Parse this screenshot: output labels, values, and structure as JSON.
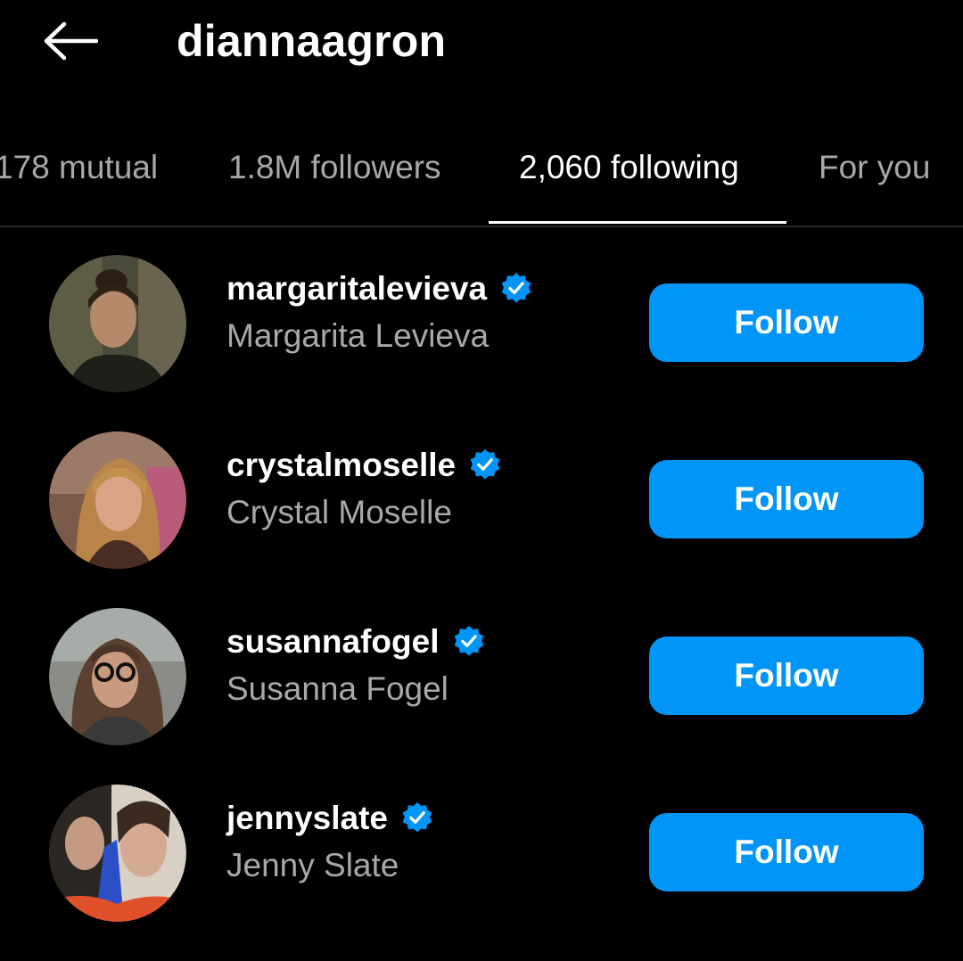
{
  "header": {
    "back_icon": "arrow-left-icon",
    "title": "diannaagron"
  },
  "tabs": [
    {
      "label": "178 mutual",
      "active": false
    },
    {
      "label": "1.8M followers",
      "active": false
    },
    {
      "label": "2,060 following",
      "active": true
    },
    {
      "label": "For you",
      "active": false
    }
  ],
  "colors": {
    "background": "#000000",
    "accent": "#0095f6",
    "secondary_text": "#a8a8a8"
  },
  "users": [
    {
      "username": "margaritalevieva",
      "name": "Margarita Levieva",
      "verified": true,
      "verified_icon": "verified-badge-icon",
      "button": "Follow"
    },
    {
      "username": "crystalmoselle",
      "name": "Crystal Moselle",
      "verified": true,
      "verified_icon": "verified-badge-icon",
      "button": "Follow"
    },
    {
      "username": "susannafogel",
      "name": "Susanna Fogel",
      "verified": true,
      "verified_icon": "verified-badge-icon",
      "button": "Follow"
    },
    {
      "username": "jennyslate",
      "name": "Jenny Slate",
      "verified": true,
      "verified_icon": "verified-badge-icon",
      "button": "Follow"
    }
  ]
}
